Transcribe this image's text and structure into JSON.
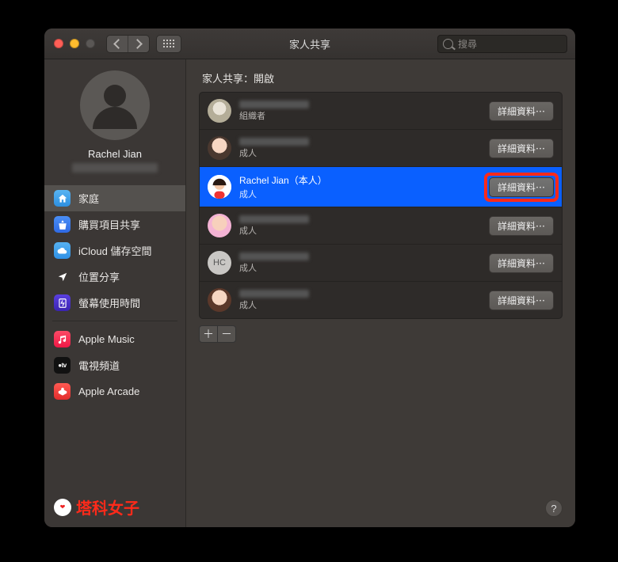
{
  "window": {
    "title": "家人共享",
    "search_placeholder": "搜尋"
  },
  "profile": {
    "name": "Rachel Jian"
  },
  "sidebar": {
    "groups": [
      [
        {
          "label": "家庭",
          "icon": "home",
          "selected": true
        },
        {
          "label": "購買項目共享",
          "icon": "app"
        },
        {
          "label": "iCloud 儲存空間",
          "icon": "cloud"
        },
        {
          "label": "位置分享",
          "icon": "location"
        },
        {
          "label": "螢幕使用時間",
          "icon": "time"
        }
      ],
      [
        {
          "label": "Apple Music",
          "icon": "music"
        },
        {
          "label": "電視頻道",
          "icon": "tv"
        },
        {
          "label": "Apple Arcade",
          "icon": "arcade"
        }
      ]
    ]
  },
  "watermark": {
    "text": "塔科女子"
  },
  "main": {
    "heading": "家人共享：開啟",
    "detail_label": "詳細資料⋯",
    "members": [
      {
        "name": "",
        "role": "組織者",
        "avatar": "av1",
        "redacted": true,
        "selected": false
      },
      {
        "name": "",
        "role": "成人",
        "avatar": "av2",
        "redacted": true,
        "selected": false
      },
      {
        "name": "Rachel Jian（本人）",
        "role": "成人",
        "avatar": "av3",
        "redacted": false,
        "selected": true,
        "highlighted": true
      },
      {
        "name": "",
        "role": "成人",
        "avatar": "av4",
        "redacted": true,
        "selected": false
      },
      {
        "name": "",
        "role": "成人",
        "avatar": "av5",
        "avatar_text": "HC",
        "redacted": true,
        "selected": false
      },
      {
        "name": "",
        "role": "成人",
        "avatar": "av6",
        "redacted": true,
        "selected": false
      }
    ],
    "add_label": "＋",
    "remove_label": "－",
    "help_label": "?"
  }
}
